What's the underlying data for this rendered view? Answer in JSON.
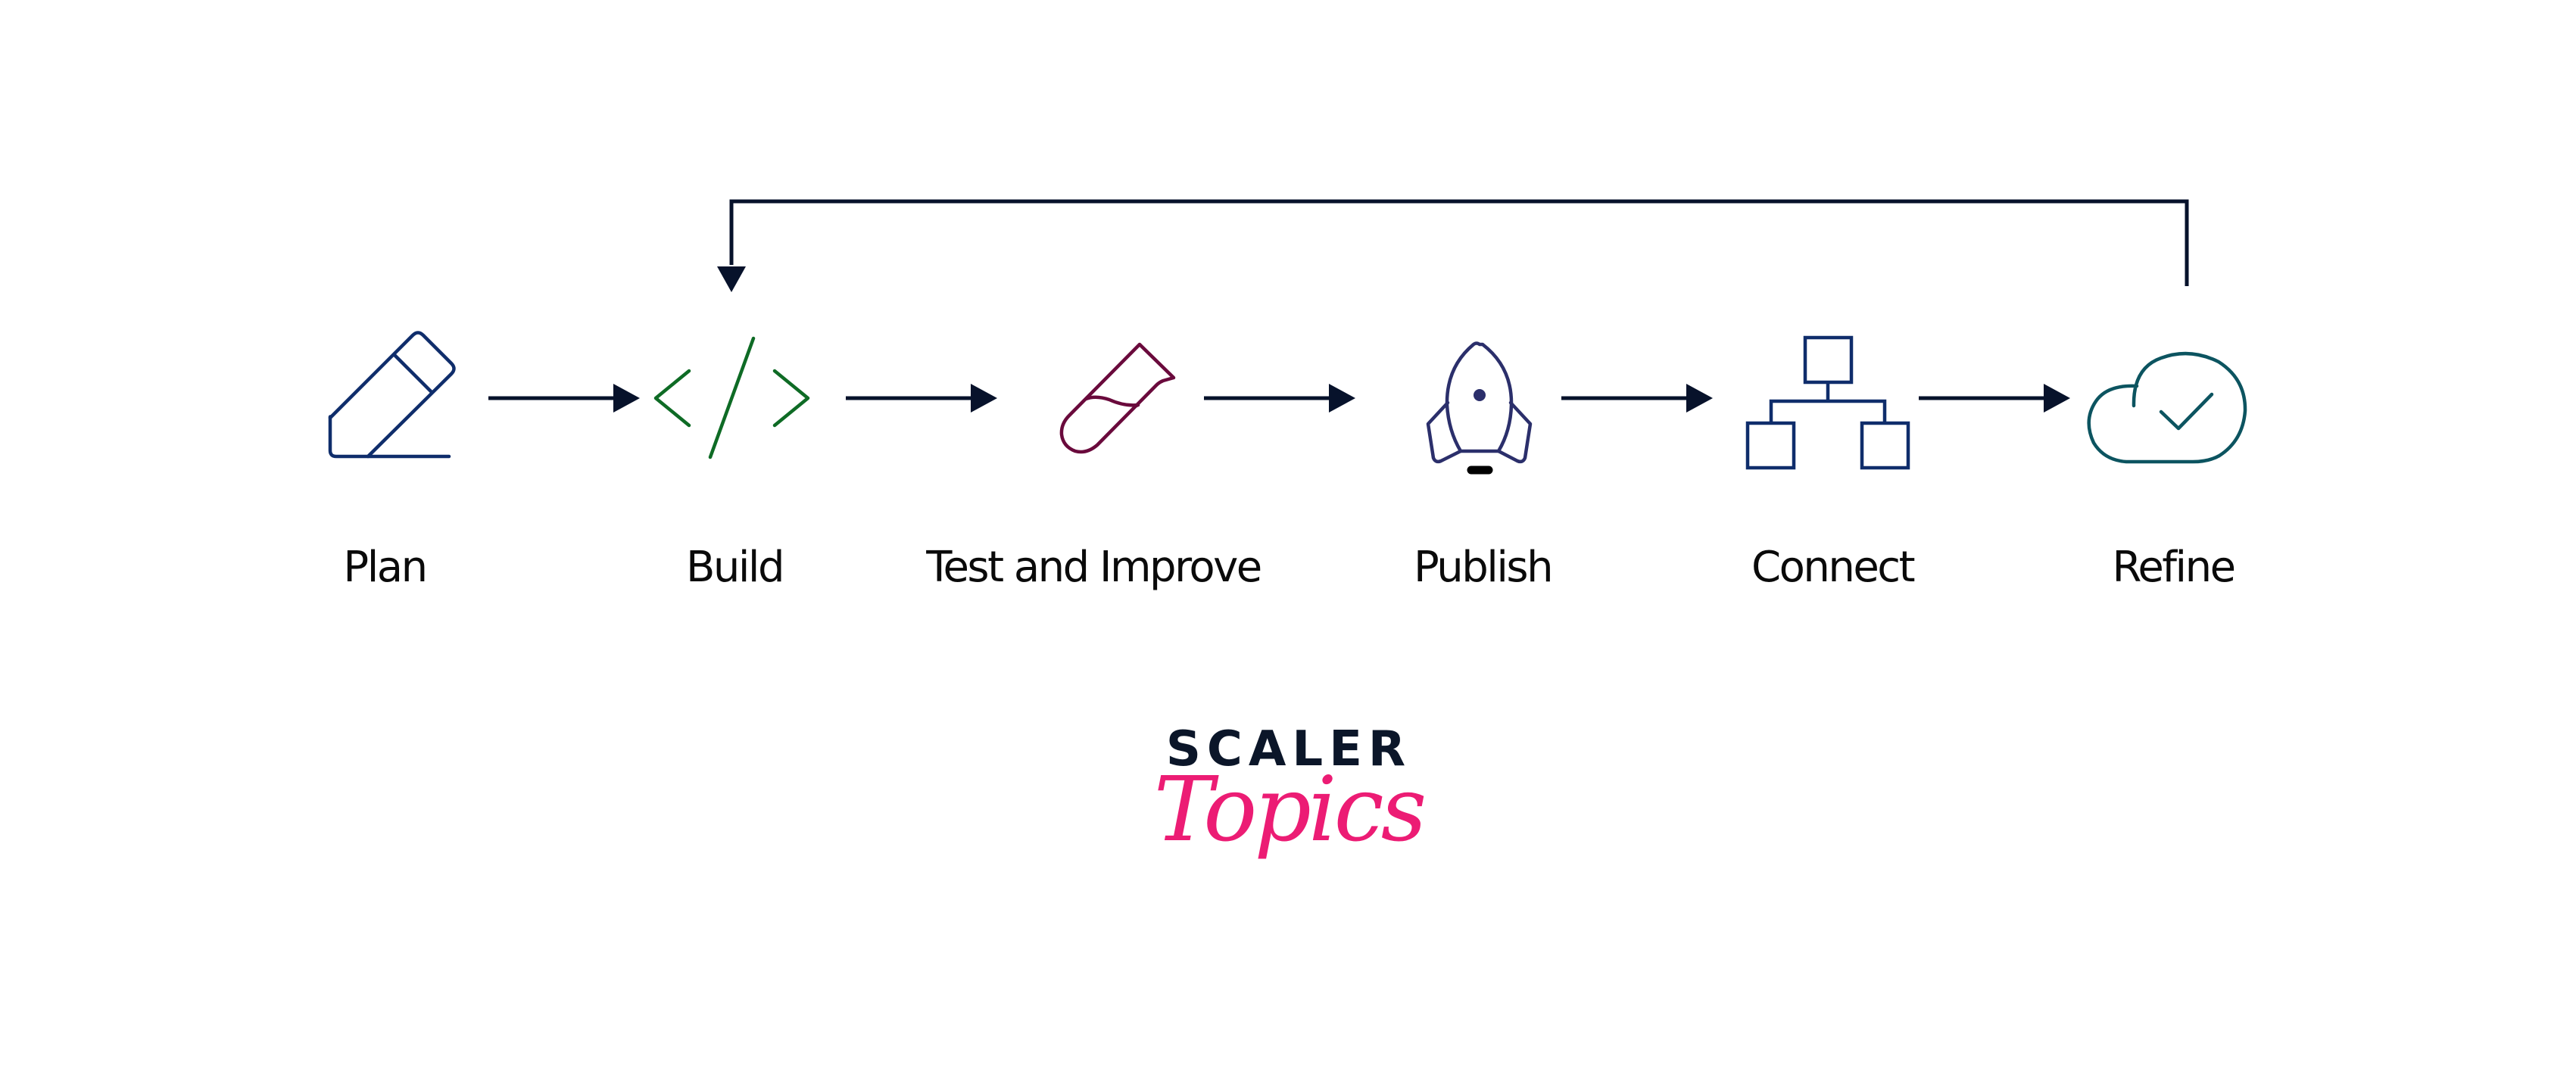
{
  "diagram": {
    "steps": [
      {
        "label": "Plan",
        "icon": "pencil-icon",
        "color": "#0f2d6b"
      },
      {
        "label": "Build",
        "icon": "code-icon",
        "color": "#0e6b25"
      },
      {
        "label": "Test and Improve",
        "icon": "test-tube-icon",
        "color": "#6a0a3c"
      },
      {
        "label": "Publish",
        "icon": "rocket-icon",
        "color": "#2b2f6b"
      },
      {
        "label": "Connect",
        "icon": "hierarchy-icon",
        "color": "#0f2d6b"
      },
      {
        "label": "Refine",
        "icon": "cloud-check-icon",
        "color": "#0c5460"
      }
    ],
    "flow": [
      {
        "from": "Plan",
        "to": "Build"
      },
      {
        "from": "Build",
        "to": "Test and Improve"
      },
      {
        "from": "Test and Improve",
        "to": "Publish"
      },
      {
        "from": "Publish",
        "to": "Connect"
      },
      {
        "from": "Connect",
        "to": "Refine"
      },
      {
        "from": "Refine",
        "to": "Build",
        "type": "feedback-loop"
      }
    ],
    "arrow_color": "#07122b"
  },
  "logo": {
    "line1": "SCALER",
    "line2": "Topics",
    "line1_color": "#0b1629",
    "line2_color": "#ec1c74"
  }
}
